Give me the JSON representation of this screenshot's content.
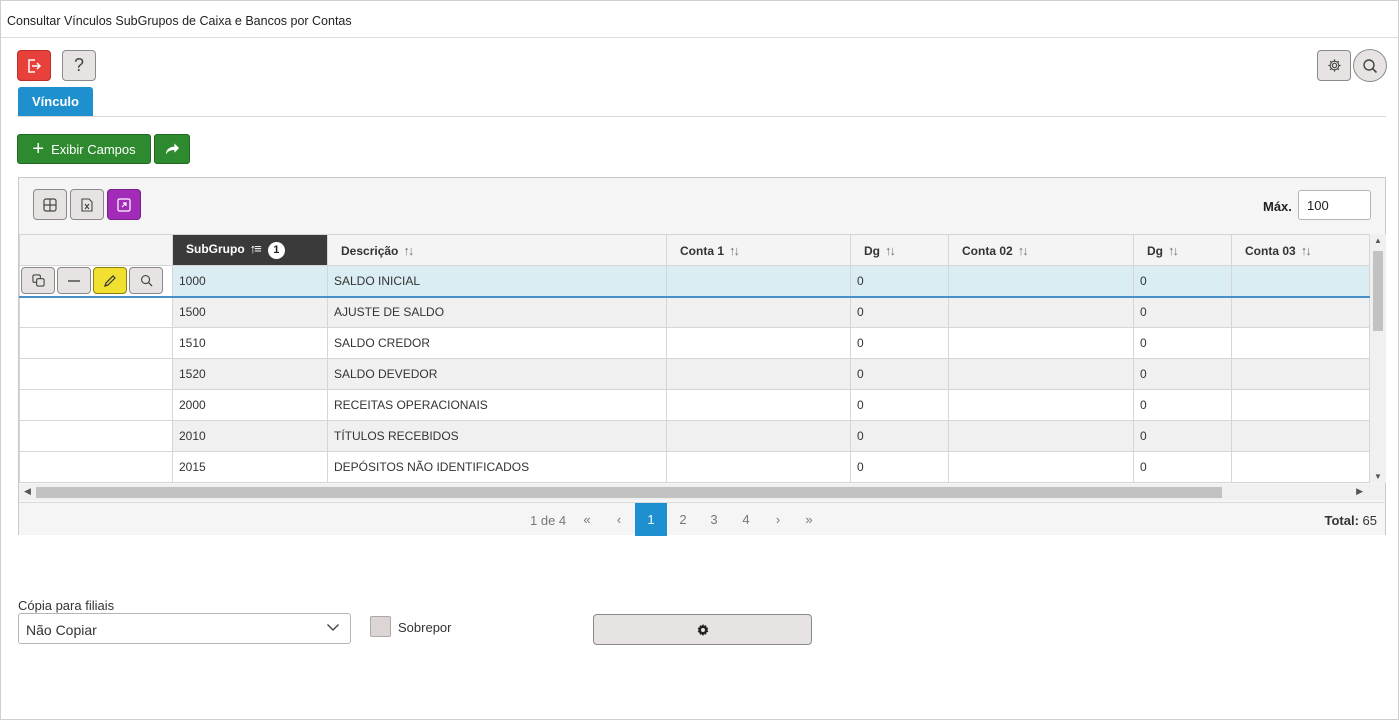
{
  "window": {
    "title": "Consultar Vínculos SubGrupos de Caixa e Bancos por Contas"
  },
  "toolbar": {
    "exit_icon": "exit-icon",
    "help_label": "?",
    "settings_icon": "gear-icon",
    "search_icon": "search-icon"
  },
  "tabs": [
    {
      "label": "Vínculo",
      "active": true
    }
  ],
  "actions": {
    "show_fields_label": "Exibir Campos",
    "share_icon": "share-icon"
  },
  "grid": {
    "tools": [
      "table-icon",
      "excel-icon",
      "expand-icon"
    ],
    "max_label": "Máx.",
    "max_value": "100",
    "columns": [
      {
        "label": "",
        "key": "actions"
      },
      {
        "label": "SubGrupo",
        "sorted": true,
        "sort_order": "1"
      },
      {
        "label": "Descrição"
      },
      {
        "label": "Conta 1"
      },
      {
        "label": "Dg"
      },
      {
        "label": "Conta 02"
      },
      {
        "label": "Dg"
      },
      {
        "label": "Conta 03"
      }
    ],
    "row_actions": [
      "copy-icon",
      "minus-icon",
      "edit-icon",
      "search-icon"
    ],
    "rows": [
      {
        "subgrupo": "1000",
        "descricao": "SALDO INICIAL",
        "conta1": "",
        "dg1": "0",
        "conta2": "",
        "dg2": "0",
        "conta3": "",
        "selected": true
      },
      {
        "subgrupo": "1500",
        "descricao": "AJUSTE DE SALDO",
        "conta1": "",
        "dg1": "0",
        "conta2": "",
        "dg2": "0",
        "conta3": ""
      },
      {
        "subgrupo": "1510",
        "descricao": "SALDO CREDOR",
        "conta1": "",
        "dg1": "0",
        "conta2": "",
        "dg2": "0",
        "conta3": ""
      },
      {
        "subgrupo": "1520",
        "descricao": "SALDO DEVEDOR",
        "conta1": "",
        "dg1": "0",
        "conta2": "",
        "dg2": "0",
        "conta3": ""
      },
      {
        "subgrupo": "2000",
        "descricao": "RECEITAS OPERACIONAIS",
        "conta1": "",
        "dg1": "0",
        "conta2": "",
        "dg2": "0",
        "conta3": ""
      },
      {
        "subgrupo": "2010",
        "descricao": "TÍTULOS RECEBIDOS",
        "conta1": "",
        "dg1": "0",
        "conta2": "",
        "dg2": "0",
        "conta3": ""
      },
      {
        "subgrupo": "2015",
        "descricao": "DEPÓSITOS NÃO IDENTIFICADOS",
        "conta1": "",
        "dg1": "0",
        "conta2": "",
        "dg2": "0",
        "conta3": ""
      }
    ],
    "pager": {
      "info": "1 de 4",
      "first": "«",
      "prev": "‹",
      "pages": [
        "1",
        "2",
        "3",
        "4"
      ],
      "current_page": "1",
      "next": "›",
      "last": "»",
      "total_label": "Total:",
      "total_value": "65"
    }
  },
  "footer": {
    "copy_label": "Cópia para filiais",
    "copy_value": "Não Copiar",
    "overwrite_label": "Sobrepor",
    "overwrite_checked": false,
    "run_icon": "gear-icon"
  },
  "colors": {
    "accent_blue": "#1e8fcf",
    "exit_red": "#e8413c",
    "action_green": "#2e8a2e",
    "expand_purple": "#a22bb8",
    "edit_yellow": "#f2e030",
    "selected_row": "#d9edf2"
  }
}
